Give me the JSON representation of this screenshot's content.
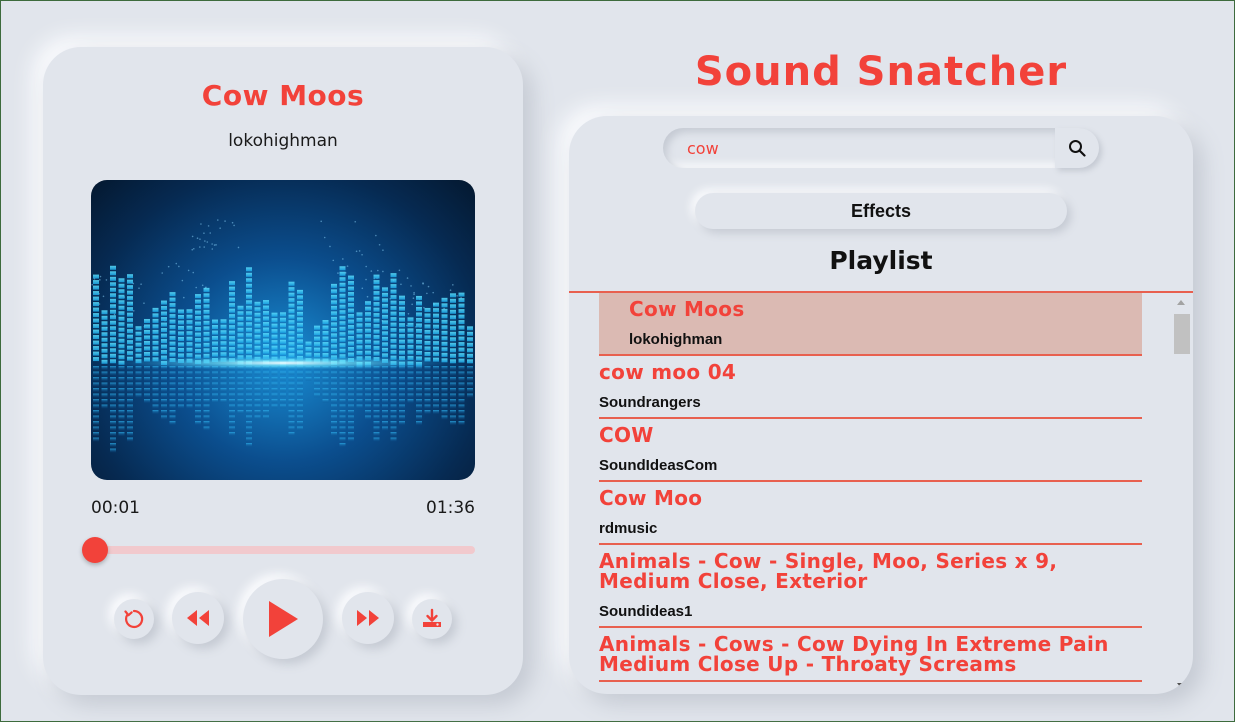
{
  "player": {
    "title": "Cow Moos",
    "artist": "lokohighman",
    "current_time": "00:01",
    "total_time": "01:36",
    "progress_fraction": 0.01,
    "album_art": "audio-equalizer-visual",
    "controls": [
      "repeat-icon",
      "rewind-icon",
      "play-icon",
      "fast-forward-icon",
      "download-icon"
    ]
  },
  "app": {
    "title": "Sound Snatcher"
  },
  "search": {
    "value": "cow",
    "icon": "search-icon"
  },
  "effects": {
    "label": "Effects"
  },
  "playlist": {
    "title": "Playlist",
    "items": [
      {
        "title": "Cow Moos",
        "artist": "lokohighman",
        "active": true
      },
      {
        "title": "cow moo 04",
        "artist": "Soundrangers",
        "active": false
      },
      {
        "title": "COW",
        "artist": "SoundIdeasCom",
        "active": false
      },
      {
        "title": "Cow Moo",
        "artist": "rdmusic",
        "active": false
      },
      {
        "title": "Animals - Cow - Single, Moo, Series x 9, Medium Close, Exterior",
        "artist": "Soundideas1",
        "active": false
      },
      {
        "title": "Animals - Cows - Cow Dying In Extreme Pain Medium Close Up - Throaty Screams",
        "artist": "",
        "active": false
      }
    ]
  },
  "colors": {
    "accent": "#f2423a",
    "background": "#e1e5ec",
    "active_row": "#dbbab3",
    "divider": "#e8604f"
  }
}
